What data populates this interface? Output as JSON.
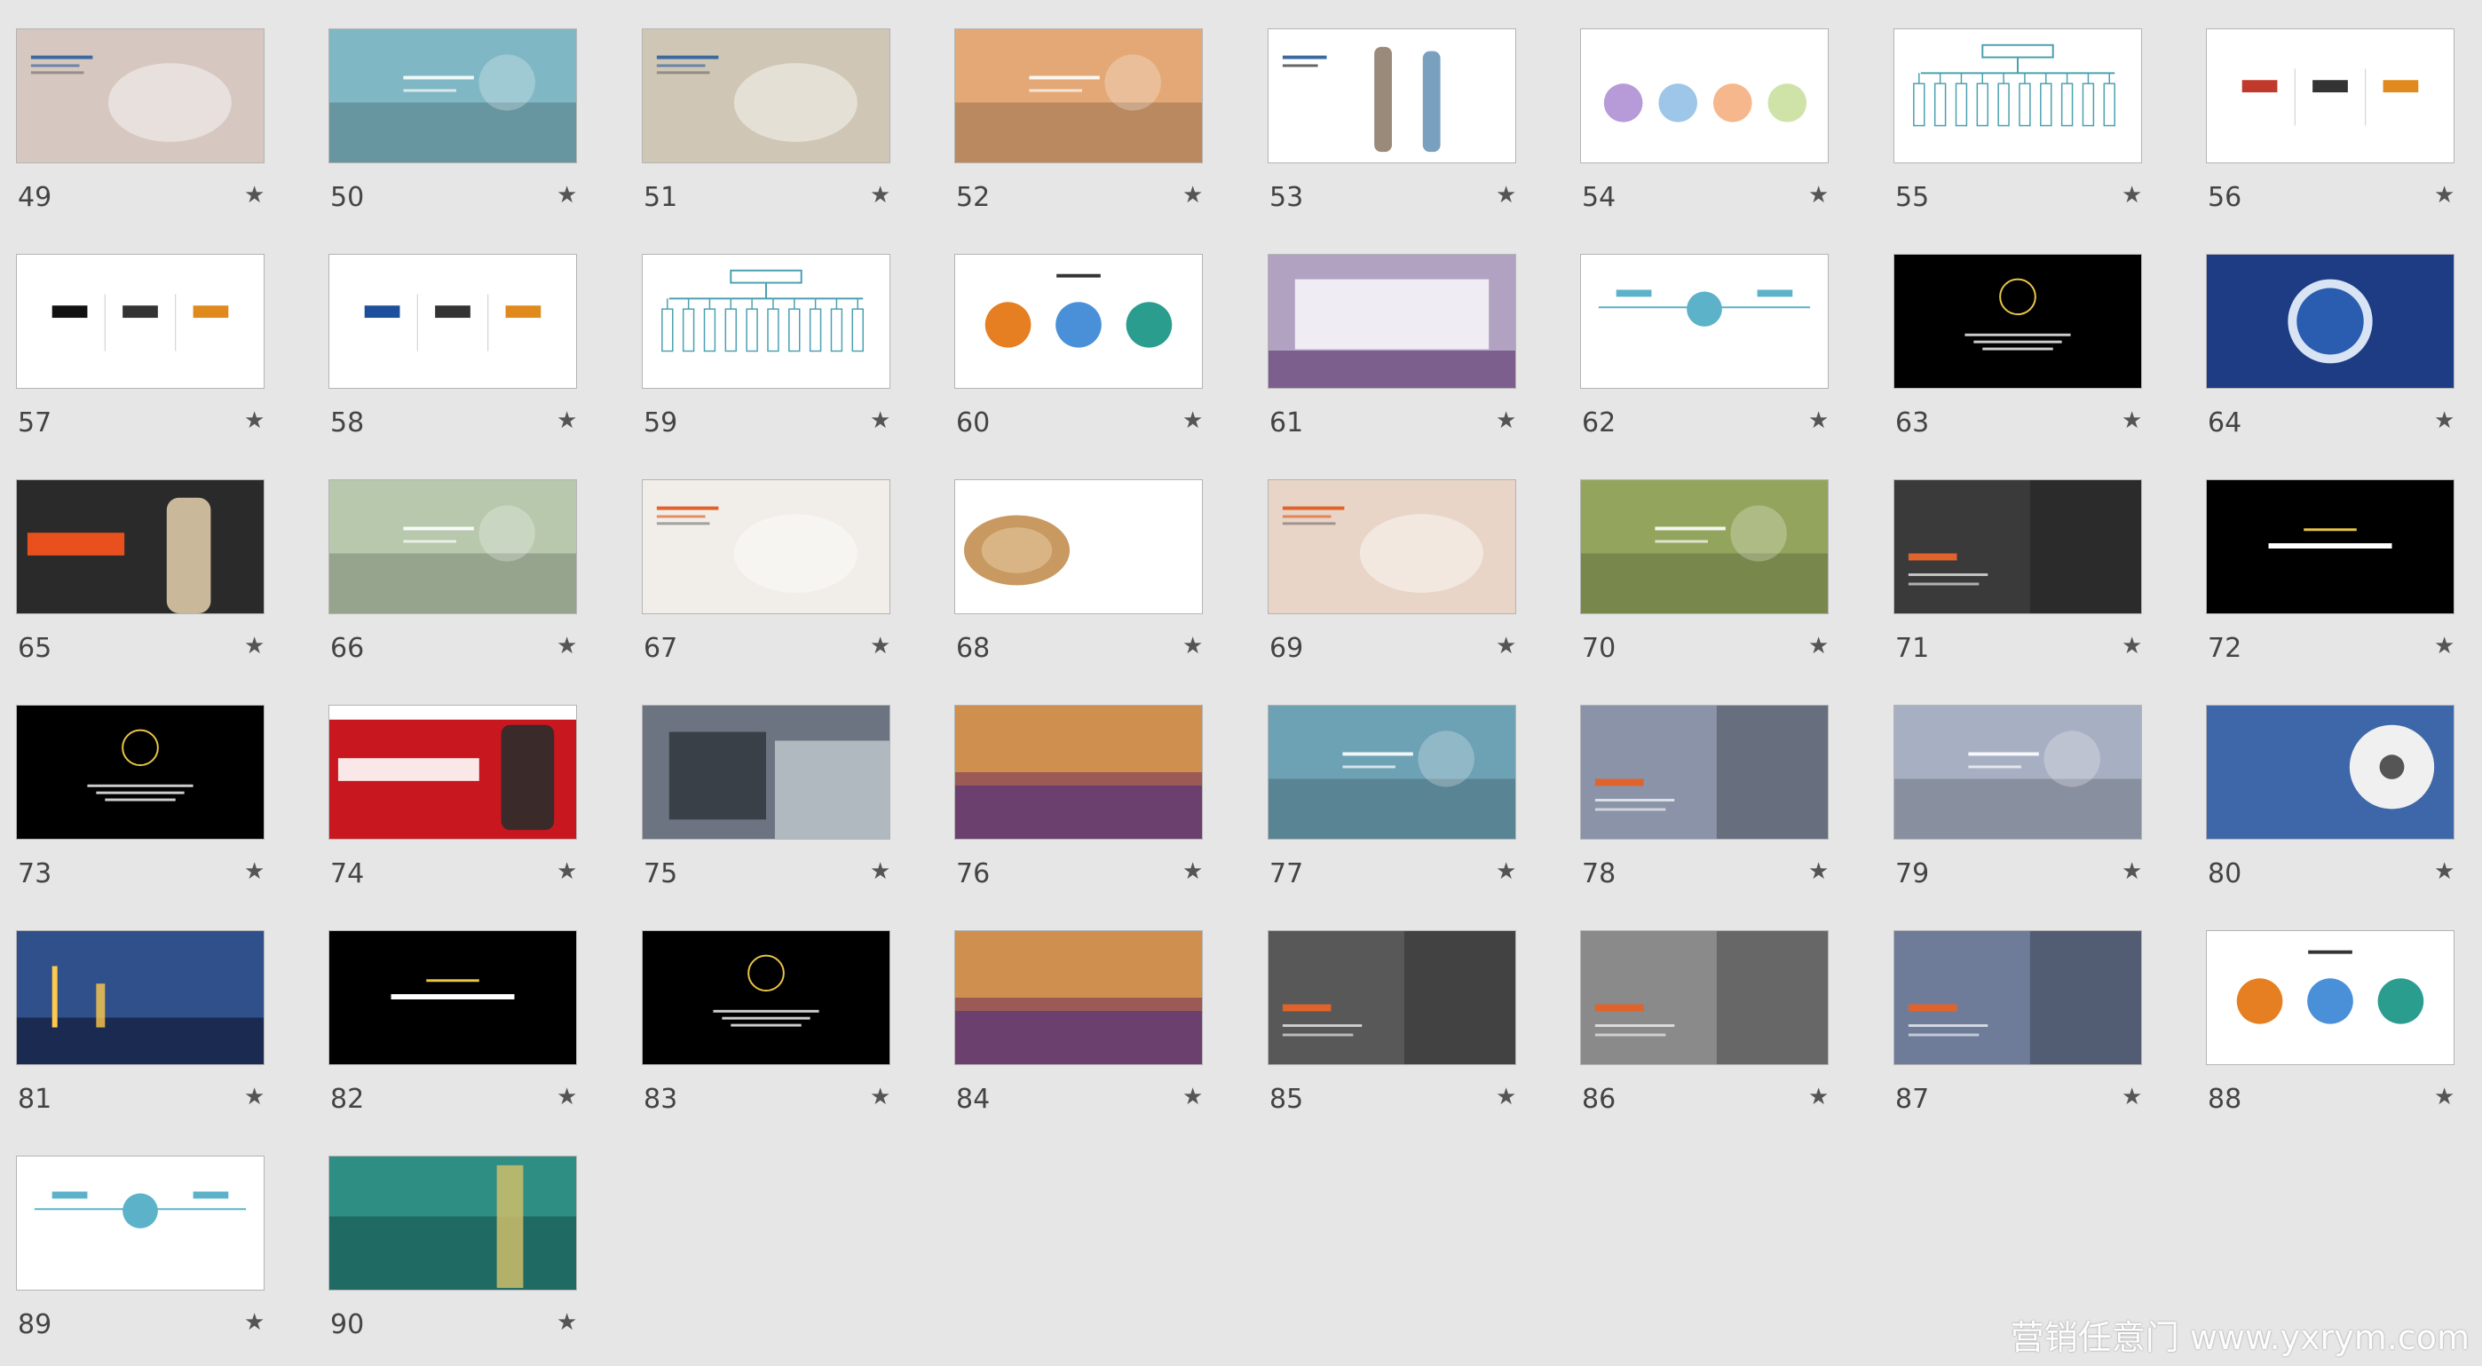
{
  "slides": [
    {
      "num": "49",
      "bg": "#d6c7c0",
      "accent": "#3a6aa0",
      "type": "photo-light"
    },
    {
      "num": "50",
      "bg": "#7fb7c4",
      "accent": "#ffffff",
      "type": "photo"
    },
    {
      "num": "51",
      "bg": "#cfc6b5",
      "accent": "#3a6aa0",
      "type": "photo-light"
    },
    {
      "num": "52",
      "bg": "#e3a876",
      "accent": "#ffffff",
      "type": "photo"
    },
    {
      "num": "53",
      "bg": "#ffffff",
      "accent": "#3a6aa0",
      "type": "people"
    },
    {
      "num": "54",
      "bg": "#ffffff",
      "accent": "#7e6fb4",
      "type": "circles4"
    },
    {
      "num": "55",
      "bg": "#ffffff",
      "accent": "#4aa0b0",
      "type": "orgchart"
    },
    {
      "num": "56",
      "bg": "#ffffff",
      "accent": "#c0392b",
      "type": "logos3"
    },
    {
      "num": "57",
      "bg": "#ffffff",
      "accent": "#111111",
      "type": "logos3"
    },
    {
      "num": "58",
      "bg": "#ffffff",
      "accent": "#1e4f9c",
      "type": "logos3"
    },
    {
      "num": "59",
      "bg": "#ffffff",
      "accent": "#4aa0b0",
      "type": "orgchart"
    },
    {
      "num": "60",
      "bg": "#ffffff",
      "accent": "#e67e22",
      "type": "circles3"
    },
    {
      "num": "61",
      "bg": "#b1a2c2",
      "accent": "#ffffff",
      "type": "textbox"
    },
    {
      "num": "62",
      "bg": "#ffffff",
      "accent": "#5bb2c9",
      "type": "timeline"
    },
    {
      "num": "63",
      "bg": "#000000",
      "accent": "#e8c547",
      "type": "dark-ring"
    },
    {
      "num": "64",
      "bg": "#1d3c84",
      "accent": "#ffffff",
      "type": "ge"
    },
    {
      "num": "65",
      "bg": "#2a2a2a",
      "accent": "#e8501e",
      "type": "alibaba"
    },
    {
      "num": "66",
      "bg": "#b7c8ac",
      "accent": "#ffffff",
      "type": "photo"
    },
    {
      "num": "67",
      "bg": "#f1ede8",
      "accent": "#e0632b",
      "type": "photo-light"
    },
    {
      "num": "68",
      "bg": "#ffffff",
      "accent": "#c89a61",
      "type": "wood"
    },
    {
      "num": "69",
      "bg": "#e8d5c7",
      "accent": "#e0632b",
      "type": "photo-light"
    },
    {
      "num": "70",
      "bg": "#93a55c",
      "accent": "#ffffff",
      "type": "photo"
    },
    {
      "num": "71",
      "bg": "#3a3a3a",
      "accent": "#e0632b",
      "type": "photo-dark"
    },
    {
      "num": "72",
      "bg": "#000000",
      "accent": "#e8c547",
      "type": "dark-text"
    },
    {
      "num": "73",
      "bg": "#000000",
      "accent": "#e8c547",
      "type": "dark-ring"
    },
    {
      "num": "74",
      "bg": "#c8171e",
      "accent": "#ffffff",
      "type": "red-banner"
    },
    {
      "num": "75",
      "bg": "#6b7480",
      "accent": "#ffffff",
      "type": "ibm"
    },
    {
      "num": "76",
      "bg": "#9b5a55",
      "accent": "#f0b24b",
      "type": "sunset"
    },
    {
      "num": "77",
      "bg": "#6da1b4",
      "accent": "#ffffff",
      "type": "photo"
    },
    {
      "num": "78",
      "bg": "#8a93a8",
      "accent": "#e0632b",
      "type": "photo-dark"
    },
    {
      "num": "79",
      "bg": "#a7afc2",
      "accent": "#ffffff",
      "type": "photo"
    },
    {
      "num": "80",
      "bg": "#3d67a8",
      "accent": "#ffffff",
      "type": "daisy"
    },
    {
      "num": "81",
      "bg": "#30508c",
      "accent": "#ffc94a",
      "type": "city"
    },
    {
      "num": "82",
      "bg": "#000000",
      "accent": "#e8c547",
      "type": "dark-text"
    },
    {
      "num": "83",
      "bg": "#000000",
      "accent": "#e8c547",
      "type": "dark-ring"
    },
    {
      "num": "84",
      "bg": "#9b5a55",
      "accent": "#f0b24b",
      "type": "sunset"
    },
    {
      "num": "85",
      "bg": "#585858",
      "accent": "#e0632b",
      "type": "photo-dark"
    },
    {
      "num": "86",
      "bg": "#8a8a8a",
      "accent": "#e0632b",
      "type": "photo-dark"
    },
    {
      "num": "87",
      "bg": "#6e7c9a",
      "accent": "#e0632b",
      "type": "photo-dark"
    },
    {
      "num": "88",
      "bg": "#ffffff",
      "accent": "#e67e22",
      "type": "circles3"
    },
    {
      "num": "89",
      "bg": "#ffffff",
      "accent": "#5bb2c9",
      "type": "timeline"
    },
    {
      "num": "90",
      "bg": "#1f6b64",
      "accent": "#d8c26a",
      "type": "underwater"
    }
  ],
  "star_glyph": "★",
  "watermark": "营销任意门 www.yxrym.com"
}
